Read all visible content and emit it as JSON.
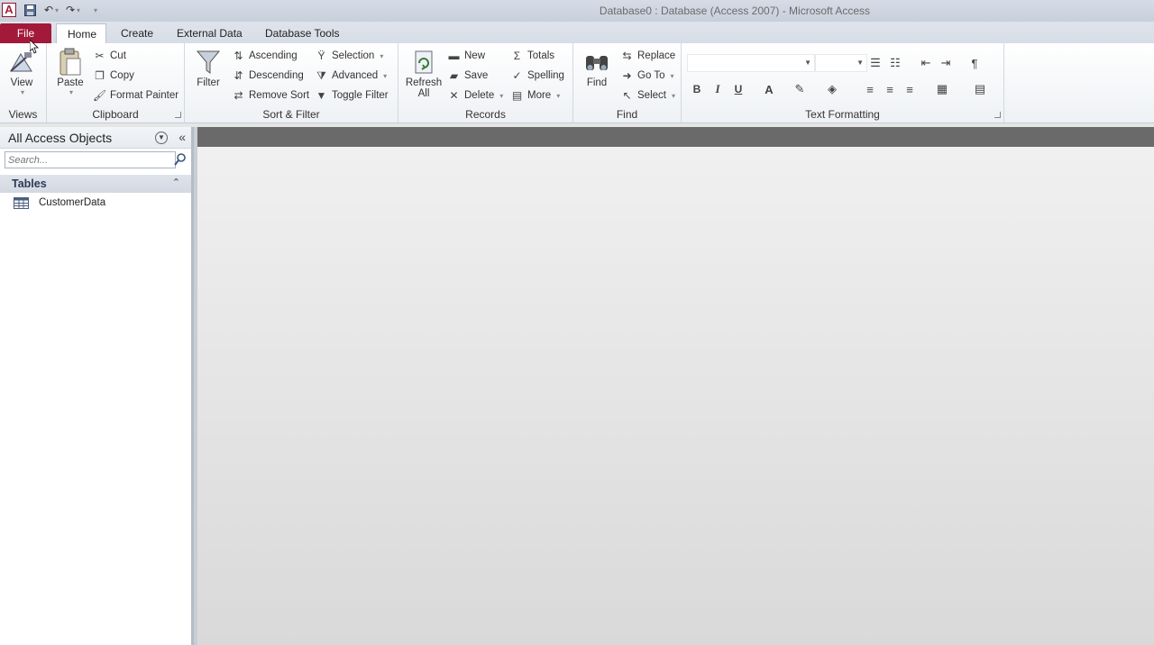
{
  "window": {
    "title": "Database0 : Database (Access 2007)  -  Microsoft Access",
    "app_icon_letter": "A"
  },
  "tabs": [
    {
      "label": "File"
    },
    {
      "label": "Home"
    },
    {
      "label": "Create"
    },
    {
      "label": "External Data"
    },
    {
      "label": "Database Tools"
    }
  ],
  "ribbon": {
    "views": {
      "label": "Views",
      "view": "View"
    },
    "clipboard": {
      "label": "Clipboard",
      "paste": "Paste",
      "cut": "Cut",
      "copy": "Copy",
      "format_painter": "Format Painter"
    },
    "sort_filter": {
      "label": "Sort & Filter",
      "filter": "Filter",
      "ascending": "Ascending",
      "descending": "Descending",
      "remove_sort": "Remove Sort",
      "selection": "Selection",
      "advanced": "Advanced",
      "toggle_filter": "Toggle Filter"
    },
    "records": {
      "label": "Records",
      "refresh_all": "Refresh All",
      "new": "New",
      "save": "Save",
      "delete": "Delete",
      "totals": "Totals",
      "spelling": "Spelling",
      "more": "More"
    },
    "find": {
      "label": "Find",
      "find": "Find",
      "replace": "Replace",
      "go_to": "Go To",
      "select": "Select"
    },
    "text_formatting": {
      "label": "Text Formatting",
      "bold": "B",
      "italic": "I",
      "underline": "U",
      "font_color": "A"
    }
  },
  "nav": {
    "header": "All Access Objects",
    "search_placeholder": "Search...",
    "section": "Tables",
    "items": [
      {
        "label": "CustomerData"
      }
    ]
  },
  "colors": {
    "file_tab": "#a3193a",
    "work_header": "#6a6a6a"
  }
}
